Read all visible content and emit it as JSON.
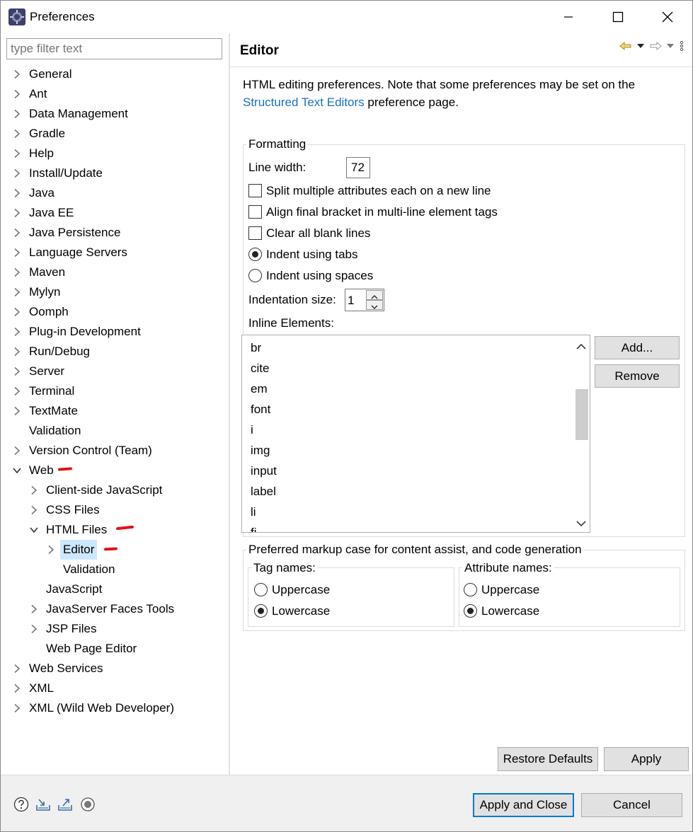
{
  "window": {
    "title": "Preferences"
  },
  "filter": {
    "placeholder": "type filter text"
  },
  "tree": [
    {
      "label": "General",
      "level": 0,
      "expander": "closed"
    },
    {
      "label": "Ant",
      "level": 0,
      "expander": "closed"
    },
    {
      "label": "Data Management",
      "level": 0,
      "expander": "closed"
    },
    {
      "label": "Gradle",
      "level": 0,
      "expander": "closed"
    },
    {
      "label": "Help",
      "level": 0,
      "expander": "closed"
    },
    {
      "label": "Install/Update",
      "level": 0,
      "expander": "closed"
    },
    {
      "label": "Java",
      "level": 0,
      "expander": "closed"
    },
    {
      "label": "Java EE",
      "level": 0,
      "expander": "closed"
    },
    {
      "label": "Java Persistence",
      "level": 0,
      "expander": "closed"
    },
    {
      "label": "Language Servers",
      "level": 0,
      "expander": "closed"
    },
    {
      "label": "Maven",
      "level": 0,
      "expander": "closed"
    },
    {
      "label": "Mylyn",
      "level": 0,
      "expander": "closed"
    },
    {
      "label": "Oomph",
      "level": 0,
      "expander": "closed"
    },
    {
      "label": "Plug-in Development",
      "level": 0,
      "expander": "closed"
    },
    {
      "label": "Run/Debug",
      "level": 0,
      "expander": "closed"
    },
    {
      "label": "Server",
      "level": 0,
      "expander": "closed"
    },
    {
      "label": "Terminal",
      "level": 0,
      "expander": "closed"
    },
    {
      "label": "TextMate",
      "level": 0,
      "expander": "closed"
    },
    {
      "label": "Validation",
      "level": 0,
      "expander": "none"
    },
    {
      "label": "Version Control (Team)",
      "level": 0,
      "expander": "closed"
    },
    {
      "label": "Web",
      "level": 0,
      "expander": "open"
    },
    {
      "label": "Client-side JavaScript",
      "level": 1,
      "expander": "closed"
    },
    {
      "label": "CSS Files",
      "level": 1,
      "expander": "closed"
    },
    {
      "label": "HTML Files",
      "level": 1,
      "expander": "open"
    },
    {
      "label": "Editor",
      "level": 2,
      "expander": "closed",
      "selected": true
    },
    {
      "label": "Validation",
      "level": 2,
      "expander": "none"
    },
    {
      "label": "JavaScript",
      "level": 1,
      "expander": "none"
    },
    {
      "label": "JavaServer Faces Tools",
      "level": 1,
      "expander": "closed"
    },
    {
      "label": "JSP Files",
      "level": 1,
      "expander": "closed"
    },
    {
      "label": "Web Page Editor",
      "level": 1,
      "expander": "none"
    },
    {
      "label": "Web Services",
      "level": 0,
      "expander": "closed"
    },
    {
      "label": "XML",
      "level": 0,
      "expander": "closed"
    },
    {
      "label": "XML (Wild Web Developer)",
      "level": 0,
      "expander": "closed"
    }
  ],
  "page": {
    "title": "Editor",
    "desc_part1": "HTML editing preferences.  Note that some preferences may be set on the",
    "desc_link": "Structured Text Editors",
    "desc_part2": " preference page."
  },
  "formatting": {
    "title": "Formatting",
    "line_width_label": "Line width:",
    "line_width_value": "72",
    "split_attrs": {
      "label": "Split multiple attributes each on a new line",
      "checked": false
    },
    "align_bracket": {
      "label": "Align final bracket in multi-line element tags",
      "checked": false
    },
    "clear_blank": {
      "label": "Clear all blank lines",
      "checked": false
    },
    "indent_tabs": {
      "label": "Indent using tabs",
      "selected": true
    },
    "indent_spaces": {
      "label": "Indent using spaces",
      "selected": false
    },
    "indent_size_label": "Indentation size:",
    "indent_size_value": "1",
    "inline_label": "Inline Elements:",
    "inline_elements": [
      "br",
      "cite",
      "em",
      "font",
      "i",
      "img",
      "input",
      "label",
      "li",
      "fi"
    ],
    "add_button": "Add...",
    "remove_button": "Remove"
  },
  "markup_case": {
    "title": "Preferred markup case for content assist, and code generation",
    "tag_names": {
      "title": "Tag names:",
      "uppercase": "Uppercase",
      "lowercase": "Lowercase",
      "selected": "lowercase"
    },
    "attr_names": {
      "title": "Attribute names:",
      "uppercase": "Uppercase",
      "lowercase": "Lowercase",
      "selected": "lowercase"
    }
  },
  "buttons": {
    "restore_defaults": "Restore Defaults",
    "apply": "Apply",
    "apply_and_close": "Apply and Close",
    "cancel": "Cancel"
  },
  "icons": {
    "app": "eclipse-gear-icon",
    "help": "help-icon",
    "import": "import-icon",
    "export": "export-icon",
    "oomph": "record-icon"
  },
  "colors": {
    "selection": "#cce8ff",
    "link": "#1a6fc8",
    "annotation": "#e0111a",
    "primary_border": "#0078d7"
  }
}
